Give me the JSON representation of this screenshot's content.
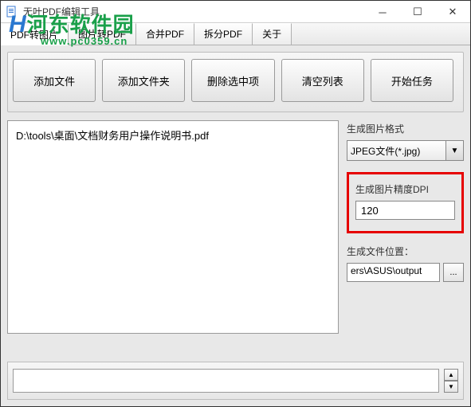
{
  "window": {
    "title": "无叶PDF编辑工具"
  },
  "watermark": {
    "line1_prefix": "H",
    "line1": "河东软件园",
    "line2": "www.pc0359.cn"
  },
  "tabs": [
    {
      "label": "PDF转图片",
      "active": true
    },
    {
      "label": "图片转PDF"
    },
    {
      "label": "合并PDF"
    },
    {
      "label": "拆分PDF"
    },
    {
      "label": "关于"
    }
  ],
  "actions": {
    "add_file": "添加文件",
    "add_folder": "添加文件夹",
    "remove_selected": "删除选中项",
    "clear_list": "清空列表",
    "start": "开始任务"
  },
  "files": [
    "D:\\tools\\桌面\\文档财务用户操作说明书.pdf"
  ],
  "side": {
    "format_label": "生成图片格式",
    "format_value": "JPEG文件(*.jpg)",
    "dpi_label": "生成图片精度DPI",
    "dpi_value": "120",
    "path_label": "生成文件位置：",
    "path_value": "ers\\ASUS\\output",
    "browse": "..."
  }
}
